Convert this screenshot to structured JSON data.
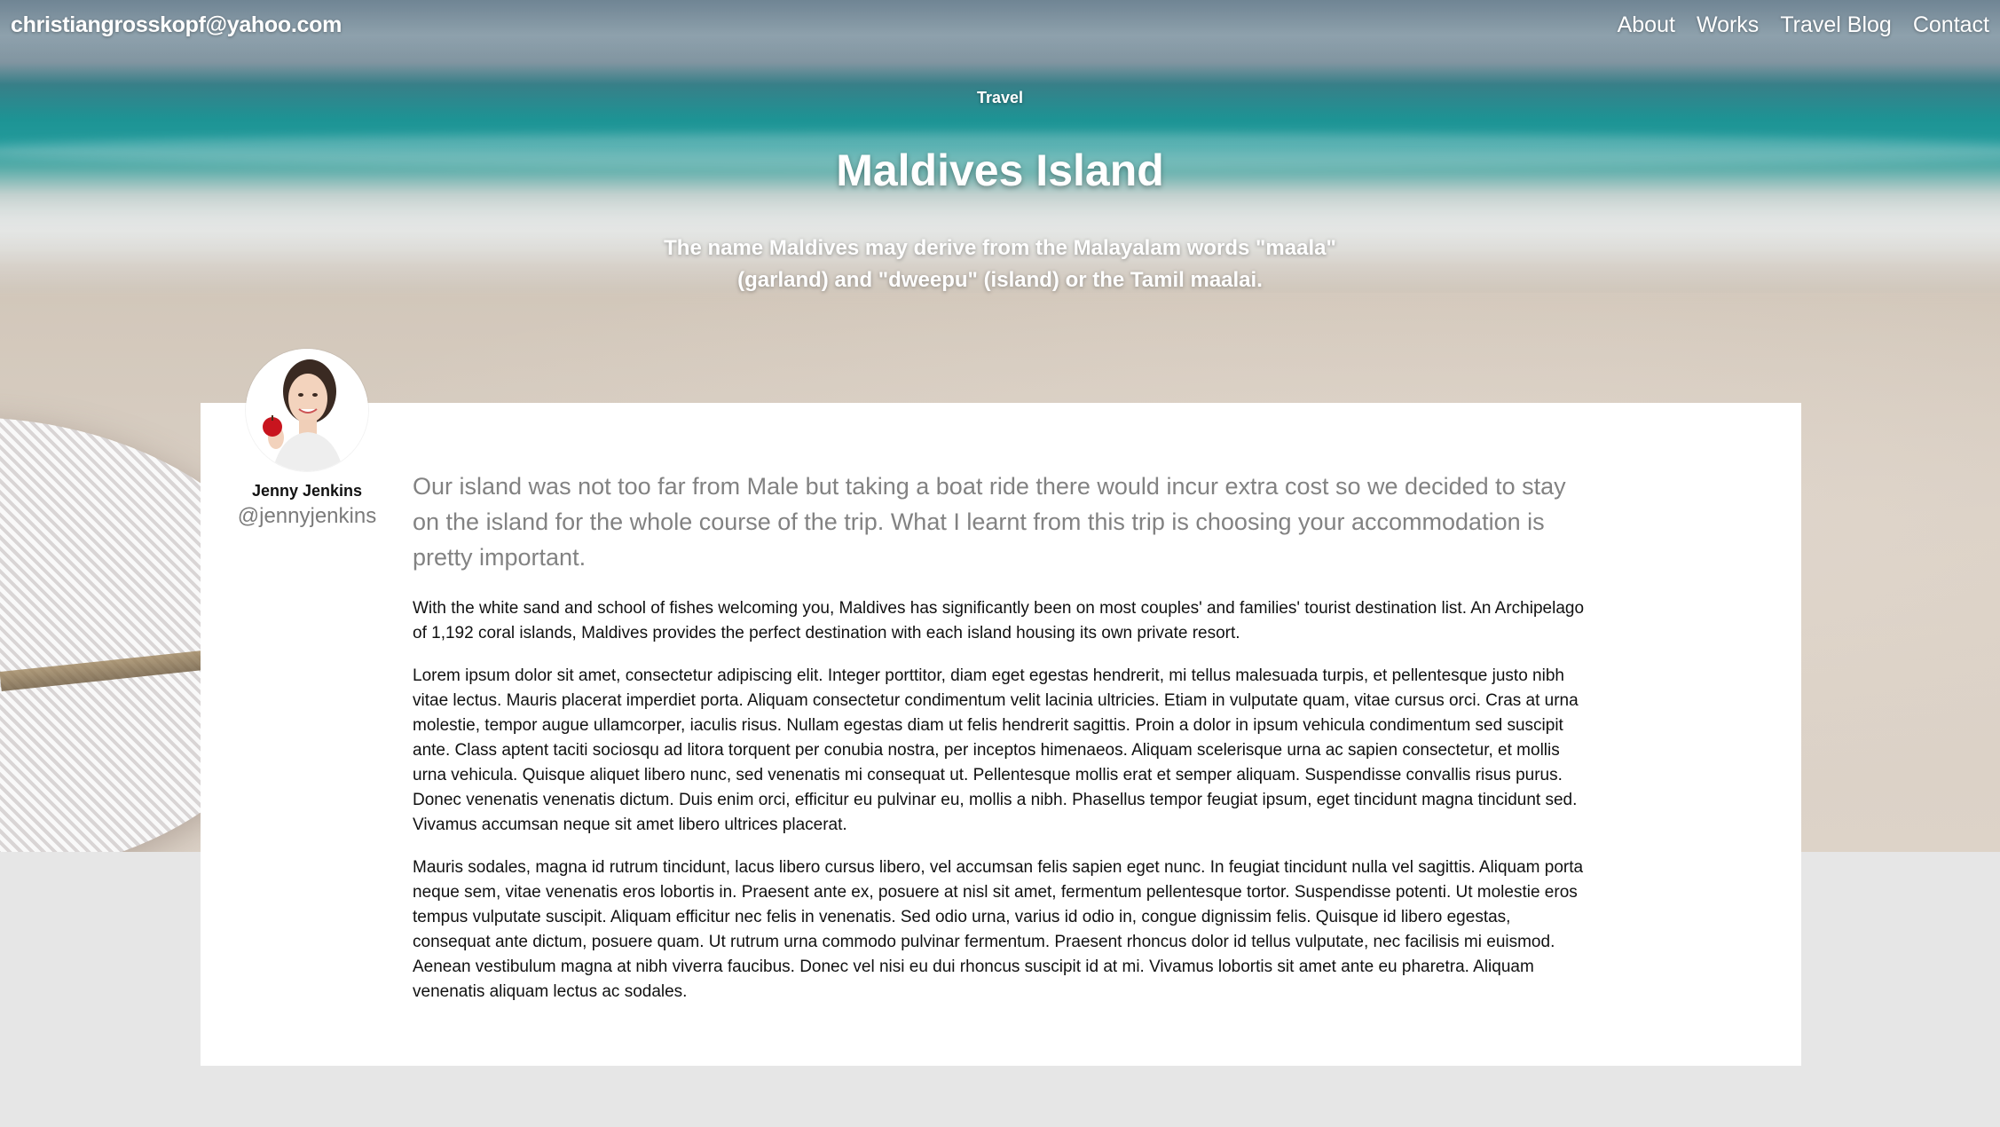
{
  "header": {
    "brand": "christiangrosskopf@yahoo.com",
    "nav": [
      {
        "label": "About"
      },
      {
        "label": "Works"
      },
      {
        "label": "Travel Blog"
      },
      {
        "label": "Contact"
      }
    ]
  },
  "hero": {
    "category": "Travel",
    "title": "Maldives Island",
    "subtitle": "The name Maldives may derive from the Malayalam words \"maala\" (garland) and \"dweepu\" (island) or the Tamil maalai."
  },
  "author": {
    "name": "Jenny Jenkins",
    "handle": "@jennyjenkins",
    "avatar_icon": "author-avatar-photo"
  },
  "article": {
    "lead": "Our island was not too far from Male but taking a boat ride there would incur extra cost so we decided to stay on the island for the whole course of the trip. What I learnt from this trip is choosing your accommodation is pretty important.",
    "paragraphs": [
      "With the white sand and school of fishes welcoming you, Maldives has significantly been on most couples' and families' tourist destination list. An Archipelago of 1,192 coral islands, Maldives provides the perfect destination with each island housing its own private resort.",
      "Lorem ipsum dolor sit amet, consectetur adipiscing elit. Integer porttitor, diam eget egestas hendrerit, mi tellus malesuada turpis, et pellentesque justo nibh vitae lectus. Mauris placerat imperdiet porta. Aliquam consectetur condimentum velit lacinia ultricies. Etiam in vulputate quam, vitae cursus orci. Cras at urna molestie, tempor augue ullamcorper, iaculis risus. Nullam egestas diam ut felis hendrerit sagittis. Proin a dolor in ipsum vehicula condimentum sed suscipit ante. Class aptent taciti sociosqu ad litora torquent per conubia nostra, per inceptos himenaeos. Aliquam scelerisque urna ac sapien consectetur, et mollis urna vehicula. Quisque aliquet libero nunc, sed venenatis mi consequat ut. Pellentesque mollis erat et semper aliquam. Suspendisse convallis risus purus. Donec venenatis venenatis dictum. Duis enim orci, efficitur eu pulvinar eu, mollis a nibh. Phasellus tempor feugiat ipsum, eget tincidunt magna tincidunt sed. Vivamus accumsan neque sit amet libero ultrices placerat.",
      "Mauris sodales, magna id rutrum tincidunt, lacus libero cursus libero, vel accumsan felis sapien eget nunc. In feugiat tincidunt nulla vel sagittis. Aliquam porta neque sem, vitae venenatis eros lobortis in. Praesent ante ex, posuere at nisl sit amet, fermentum pellentesque tortor. Suspendisse potenti. Ut molestie eros tempus vulputate suscipit. Aliquam efficitur nec felis in venenatis. Sed odio urna, varius id odio in, congue dignissim felis. Quisque id libero egestas, consequat ante dictum, posuere quam. Ut rutrum urna commodo pulvinar fermentum. Praesent rhoncus dolor id tellus vulputate, nec facilisis mi euismod. Aenean vestibulum magna at nibh viverra faucibus. Donec vel nisi eu dui rhoncus suscipit id at mi. Vivamus lobortis sit amet ante eu pharetra. Aliquam venenatis aliquam lectus ac sodales."
    ]
  }
}
